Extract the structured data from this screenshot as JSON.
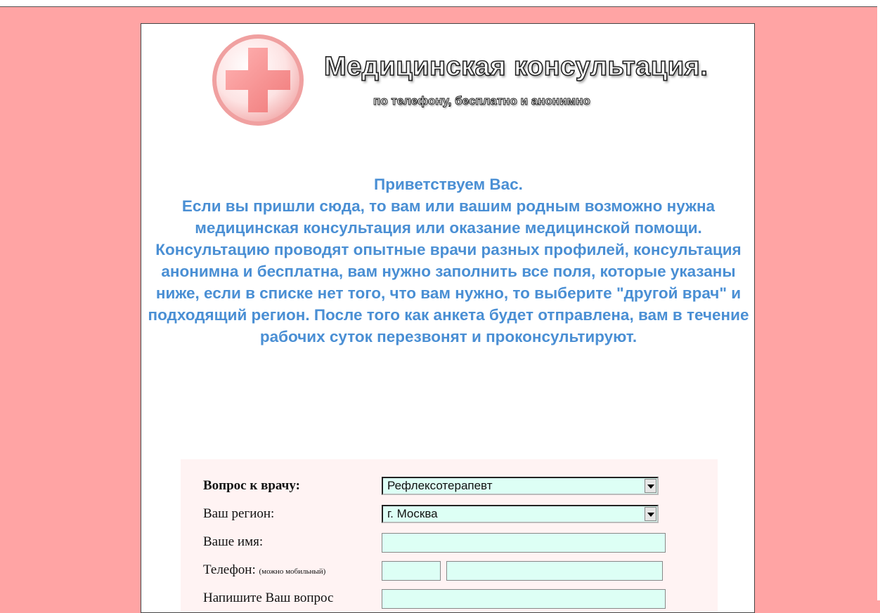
{
  "header": {
    "title": "Медицинская консультация.",
    "subtitle": "по телефону, бесплатно и анонимно",
    "logo_icon": "red-cross-icon"
  },
  "welcome": {
    "greeting": "Приветствуем Вас.",
    "text": "Если вы пришли сюда, то вам или вашим родным возможно нужна медицинская консультация или оказание медицинской помощи. Консультацию проводят опытные врачи разных профилей, консультация анонимна и бесплатна, вам нужно заполнить все поля, которые указаны ниже, если в списке нет того, что вам нужно, то выберите \"другой врач\" и подходящий регион. После того как анкета будет отправлена, вам в течение рабочих суток перезвонят и проконсультируют."
  },
  "form": {
    "doctor_label": "Вопрос к врачу:",
    "doctor_value": "Рефлексотерапевт",
    "region_label": "Ваш регион:",
    "region_value": "г. Москва",
    "name_label": "Ваше имя:",
    "phone_label": "Телефон:",
    "phone_hint": "(можно мобильный)",
    "question_label": "Напишите Ваш вопрос"
  },
  "colors": {
    "background": "#ffa4a4",
    "welcome_text": "#4a8fd4",
    "field_fill": "#ddfff5",
    "form_fill": "#fff3f3"
  }
}
